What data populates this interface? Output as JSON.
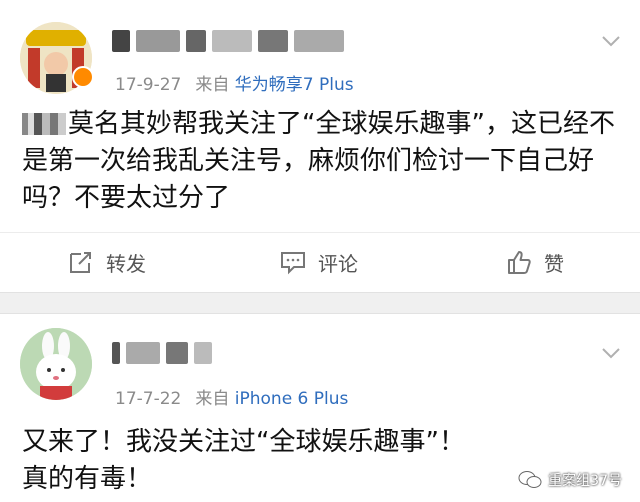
{
  "posts": [
    {
      "date": "17-9-27",
      "source_prefix": "来自",
      "source": "华为畅享7 Plus",
      "content": "莫名其妙帮我关注了“全球娱乐趣事”，这已经不是第一次给我乱关注号，麻烦你们检讨一下自己好吗？不要太过分了",
      "actions": {
        "repost": "转发",
        "comment": "评论",
        "like": "赞"
      }
    },
    {
      "date": "17-7-22",
      "source_prefix": "来自",
      "source": "iPhone 6 Plus",
      "content_line1": "又来了！我没关注过“全球娱乐趣事”！",
      "content_line2": "真的有毒！"
    }
  ],
  "watermark": "重案组37号",
  "colors": {
    "source_link": "#2f6dbd",
    "meta": "#8a8a8a",
    "badge": "#ff8a00",
    "divider": "#f0f0f0"
  }
}
